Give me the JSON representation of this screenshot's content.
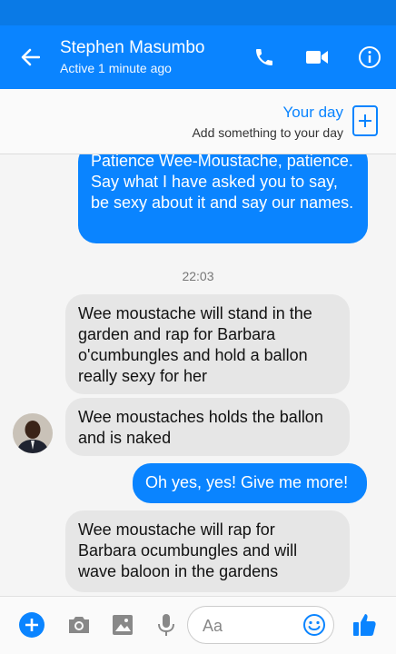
{
  "header": {
    "contact_name": "Stephen Masumbo",
    "status": "Active 1 minute ago",
    "accent_color": "#0a84ff"
  },
  "your_day": {
    "title": "Your day",
    "subtitle": "Add something to your day"
  },
  "conversation": {
    "timestamp": "22:03",
    "messages": [
      {
        "direction": "outgoing",
        "text": "Patience Wee-Moustache, patience. Say what I have asked you to say, be sexy about it and say our names."
      },
      {
        "direction": "incoming",
        "text": "Wee moustache will stand in the garden and rap for Barbara o'cumbungles and hold a ballon really sexy for her"
      },
      {
        "direction": "incoming",
        "text": "Wee moustaches holds the ballon and is naked"
      },
      {
        "direction": "outgoing",
        "text": "Oh yes, yes! Give me more!"
      },
      {
        "direction": "incoming",
        "text": "Wee moustache will rap for Barbara ocumbungles and will wave baloon in the gardens"
      }
    ]
  },
  "composer": {
    "placeholder": "Aa",
    "icons": [
      "plus-icon",
      "camera-icon",
      "image-icon",
      "microphone-icon",
      "emoji-icon",
      "thumbs-up-icon"
    ]
  }
}
